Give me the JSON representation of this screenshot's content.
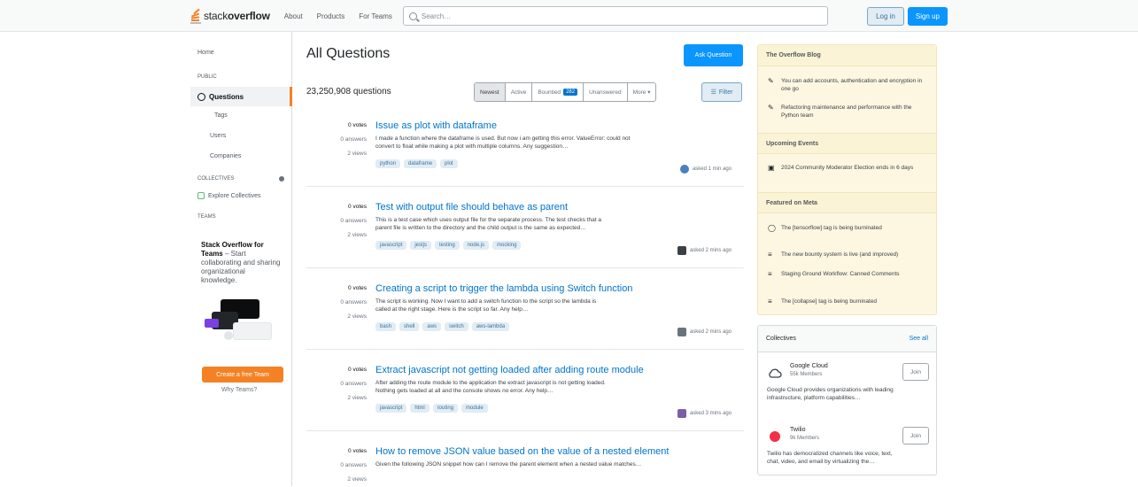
{
  "topbar": {
    "logo_text_light": "stack",
    "logo_text_bold": "overflow",
    "nav": [
      "About",
      "Products",
      "For Teams"
    ],
    "search_placeholder": "Search…",
    "login": "Log in",
    "signup": "Sign up"
  },
  "leftnav": {
    "home": "Home",
    "public": "PUBLIC",
    "questions": "Questions",
    "tags": "Tags",
    "users": "Users",
    "companies": "Companies",
    "collectives": "COLLECTIVES",
    "explore_collectives": "Explore Collectives",
    "teams": "TEAMS",
    "teams_title_bold": "Stack Overflow for Teams",
    "teams_title_rest": " – Start collaborating and sharing organizational knowledge.",
    "create_team": "Create a free Team",
    "why_teams": "Why Teams?"
  },
  "main": {
    "title": "All Questions",
    "ask_button": "Ask Question",
    "count": "23,250,908 questions",
    "tabs": [
      {
        "label": "Newest",
        "active": true
      },
      {
        "label": "Active"
      },
      {
        "label": "Bountied",
        "badge": "282"
      },
      {
        "label": "Unanswered"
      },
      {
        "label": "More ▾"
      }
    ],
    "filter": "Filter",
    "questions": [
      {
        "votes": "0 votes",
        "answers": "0 answers",
        "views": "2 views",
        "title": "Issue as plot with dataframe",
        "excerpt_1": "I made a function where the dataframe is used. But now i am getting this error. ValueError: could not",
        "excerpt_2": "convert to float while making a plot with multiple columns. Any suggestion…",
        "tags": [
          "python",
          "dataframe",
          "plot"
        ],
        "user": "asked 1 min ago",
        "avatar_color": "#4a7fc1"
      },
      {
        "votes": "0 votes",
        "answers": "0 answers",
        "views": "2 views",
        "title": "Test with output file should behave as parent",
        "excerpt_1": "This is a test case which uses output file for the separate process. The test checks that a",
        "excerpt_2": "parent file is written to the directory and the child output is the same as expected…",
        "tags": [
          "javascript",
          "jestjs",
          "testing",
          "node.js",
          "mocking"
        ],
        "user": "asked 2 mins ago",
        "avatar_color": "#3b4045"
      },
      {
        "votes": "0 votes",
        "answers": "0 answers",
        "views": "2 views",
        "title": "Creating a script to trigger the lambda using Switch function",
        "excerpt_1": "The script is working. Now I want to add a switch function to the script so the lambda is",
        "excerpt_2": "called at the right stage. Here is the script so far. Any help…",
        "tags": [
          "bash",
          "shell",
          "aws",
          "switch",
          "aws-lambda"
        ],
        "user": "asked 2 mins ago",
        "avatar_color": "#6a737c"
      },
      {
        "votes": "0 votes",
        "answers": "0 answers",
        "views": "2 views",
        "title": "Extract javascript not getting loaded after adding route module",
        "excerpt_1": "After adding the route module to the application the extract javascript is not getting loaded.",
        "excerpt_2": "Nothing gets loaded at all and the console shows no error. Any help…",
        "tags": [
          "javascript",
          "html",
          "routing",
          "module"
        ],
        "user": "asked 3 mins ago",
        "avatar_color": "#7b5ea7"
      },
      {
        "votes": "0 votes",
        "answers": "0 answers",
        "views": "2 views",
        "title": "How to remove JSON value based on the value of a nested element",
        "excerpt_1": "Given the following JSON snippet how can I remove the parent element when a nested value matches…",
        "excerpt_2": "",
        "tags": [],
        "user": "",
        "avatar_color": "#6a737c"
      }
    ]
  },
  "sidebar": {
    "blog_heading": "The Overflow Blog",
    "blog_items": [
      "You can add accounts, authentication and encryption in one go",
      "Refactoring maintenance and performance with the Python team"
    ],
    "featured_heading": "Upcoming Events",
    "featured_items": [
      "2024 Community Moderator Election ends in 6 days"
    ],
    "meta_heading": "Featured on Meta",
    "meta_items": [
      "The [tensorflow] tag is being burninated",
      "The new bounty system is live (and improved)",
      "Staging Ground Workflow: Canned Comments",
      "The [collapse] tag is being burninated"
    ],
    "collectives_heading": "Collectives",
    "see_all": "See all",
    "collectives": [
      {
        "name": "Google Cloud",
        "members": "55k Members",
        "join": "Join",
        "desc_1": "Google Cloud provides organizations with leading",
        "desc_2": "infrastructure, platform capabilities…"
      },
      {
        "name": "Twilio",
        "members": "9k Members",
        "join": "Join",
        "desc_1": "Twilio has democratized channels like voice, text,",
        "desc_2": "chat, video, and email by virtualizing the…"
      }
    ]
  },
  "colors": {
    "accent": "#f48225",
    "link": "#0074cc",
    "primary_button": "#0a95ff",
    "blog_bg": "#fdf7e2",
    "tag_bg": "#e1ecf4"
  }
}
